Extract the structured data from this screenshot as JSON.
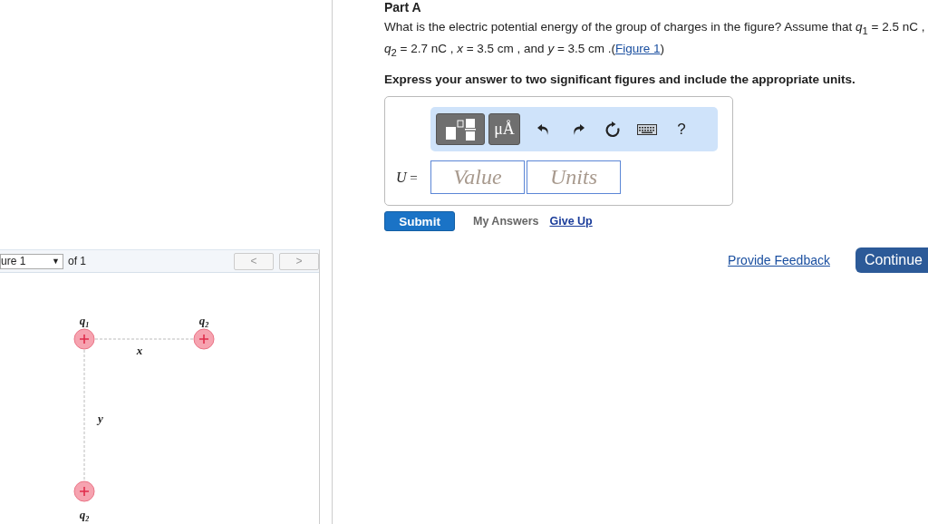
{
  "figure_panel": {
    "selector": "ure 1",
    "selector_caret": "▼",
    "count": "of 1",
    "prev": "<",
    "next": ">",
    "prev_disabled": true,
    "next_disabled": true,
    "charges": [
      {
        "label": "q",
        "sub": "1"
      },
      {
        "label": "q",
        "sub": "2"
      },
      {
        "label": "q",
        "sub": "2"
      }
    ],
    "distances": [
      {
        "label": "x"
      },
      {
        "label": "y"
      }
    ]
  },
  "part": {
    "title": "Part A",
    "question": "What is the electric potential energy of the group of charges in the figure? Assume that *q*$_{1}$ = 2.5 nC , *q*$_{2}$ = 2.7 nC , *x* = 3.5 cm , and *y* = 3.5 cm .(",
    "question_link": "Figure 1",
    "question_end": ")",
    "instruction": "Express your answer to two significant figures and include the appropriate units.",
    "toolbar": [
      {
        "kind": "templates"
      },
      {
        "kind": "symbols",
        "label": "μÅ"
      },
      {
        "kind": "undo"
      },
      {
        "kind": "redo"
      },
      {
        "kind": "reset"
      },
      {
        "kind": "keyboard"
      },
      {
        "kind": "help",
        "label": "?"
      }
    ],
    "variable": "U",
    "equals": "=",
    "value_placeholder": "Value",
    "units_placeholder": "Units",
    "submit": "Submit",
    "my_answers": "My Answers",
    "give_up": "Give Up"
  },
  "footer": {
    "feedback": "Provide Feedback",
    "continue": "Continue"
  }
}
